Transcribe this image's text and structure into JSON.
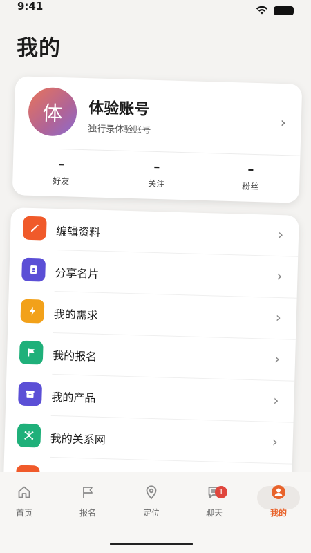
{
  "status_bar": {
    "time": "9:41"
  },
  "page": {
    "title": "我的"
  },
  "profile": {
    "avatar_text": "体",
    "name": "体验账号",
    "subtitle": "独行录体验账号",
    "stats": [
      {
        "value": "–",
        "label": "好友"
      },
      {
        "value": "–",
        "label": "关注"
      },
      {
        "value": "–",
        "label": "粉丝"
      }
    ]
  },
  "menu": {
    "items": [
      {
        "label": "编辑资料",
        "icon": "edit-icon",
        "color": "#f05a2a"
      },
      {
        "label": "分享名片",
        "icon": "card-icon",
        "color": "#5b4fd6"
      },
      {
        "label": "我的需求",
        "icon": "bolt-icon",
        "color": "#f2a11a"
      },
      {
        "label": "我的报名",
        "icon": "flag-icon",
        "color": "#1fb07a"
      },
      {
        "label": "我的产品",
        "icon": "box-icon",
        "color": "#5b4fd6"
      },
      {
        "label": "我的关系网",
        "icon": "network-icon",
        "color": "#1fb07a"
      }
    ]
  },
  "tab_bar": {
    "tabs": [
      {
        "label": "首页",
        "icon": "home-icon"
      },
      {
        "label": "报名",
        "icon": "flag-icon"
      },
      {
        "label": "定位",
        "icon": "location-pin-icon"
      },
      {
        "label": "聊天",
        "icon": "chat-icon",
        "badge": "1"
      },
      {
        "label": "我的",
        "icon": "profile-icon",
        "active": true
      }
    ]
  },
  "colors": {
    "accent": "#e8632b",
    "badge": "#e0463d"
  }
}
